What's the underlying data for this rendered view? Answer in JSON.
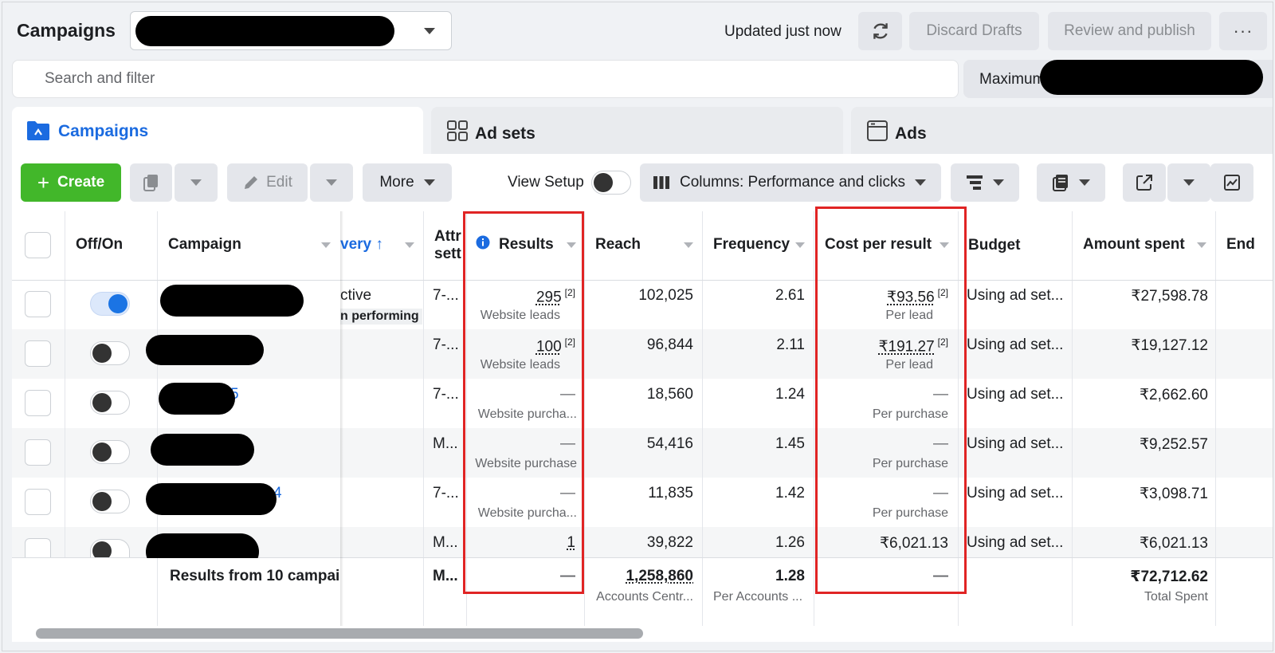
{
  "header": {
    "title": "Campaigns",
    "updated": "Updated just now",
    "discard_label": "Discard Drafts",
    "publish_label": "Review and publish",
    "overflow_label": "···"
  },
  "search": {
    "placeholder": "Search and filter"
  },
  "date_range": {
    "label_prefix": "Maximum"
  },
  "tabs": [
    {
      "label": "Campaigns",
      "icon": "folder-icon",
      "active": true
    },
    {
      "label": "Ad sets",
      "icon": "grid-icon"
    },
    {
      "label": "Ads",
      "icon": "ad-window-icon"
    }
  ],
  "toolbar": {
    "create_label": "Create",
    "edit_label": "Edit",
    "more_label": "More",
    "view_setup_label": "View Setup",
    "columns_label": "Columns: Performance and clicks"
  },
  "table": {
    "columns": {
      "offon": "Off/On",
      "campaign": "Campaign",
      "delivery": "very",
      "attribution_1": "Attr",
      "attribution_2": "sett",
      "results": "Results",
      "reach": "Reach",
      "frequency": "Frequency",
      "cost": "Cost per result",
      "budget": "Budget",
      "spent": "Amount spent",
      "ends": "End"
    },
    "rows": [
      {
        "active": true,
        "delivery": "ctive",
        "delivery_badge": "n performing",
        "attribution": "7-...",
        "results": "295",
        "results_note": "[2]",
        "results_type": "Website leads",
        "reach": "102,025",
        "frequency": "2.61",
        "cost": "₹93.56",
        "cost_note": "[2]",
        "cost_type": "Per lead",
        "budget": "Using ad set...",
        "spent": "₹27,598.78"
      },
      {
        "active": false,
        "attribution": "7-...",
        "results": "100",
        "results_note": "[2]",
        "results_type": "Website leads",
        "reach": "96,844",
        "frequency": "2.11",
        "cost": "₹191.27",
        "cost_note": "[2]",
        "cost_type": "Per lead",
        "budget": "Using ad set...",
        "spent": "₹19,127.12"
      },
      {
        "active": false,
        "name_tail": "5",
        "attribution": "7-...",
        "results": "—",
        "results_type": "Website purcha...",
        "reach": "18,560",
        "frequency": "1.24",
        "cost": "—",
        "cost_type": "Per purchase",
        "budget": "Using ad set...",
        "spent": "₹2,662.60"
      },
      {
        "active": false,
        "attribution": "M...",
        "results": "—",
        "results_type": "Website purchase",
        "reach": "54,416",
        "frequency": "1.45",
        "cost": "—",
        "cost_type": "Per purchase",
        "budget": "Using ad set...",
        "spent": "₹9,252.57"
      },
      {
        "active": false,
        "name_tail": "4",
        "attribution": "7-...",
        "results": "—",
        "results_type": "Website purcha...",
        "reach": "11,835",
        "frequency": "1.42",
        "cost": "—",
        "cost_type": "Per purchase",
        "budget": "Using ad set...",
        "spent": "₹3,098.71"
      },
      {
        "active": false,
        "attribution": "M...",
        "results": "1",
        "results_type": "",
        "reach": "39,822",
        "frequency": "1.26",
        "cost": "₹6,021.13",
        "cost_type": "",
        "budget": "Using ad set...",
        "spent": "₹6,021.13"
      }
    ],
    "summary": {
      "label": "Results from 10 campaig",
      "attribution": "M...",
      "results": "—",
      "reach": "1,258,860",
      "reach_sub": "Accounts Centr...",
      "frequency": "1.28",
      "frequency_sub": "Per Accounts ...",
      "cost": "—",
      "spent": "₹72,712.62",
      "spent_sub": "Total Spent"
    }
  },
  "colors": {
    "accent": "#1b6be0",
    "create": "#42b72a",
    "highlight": "#e02424"
  }
}
